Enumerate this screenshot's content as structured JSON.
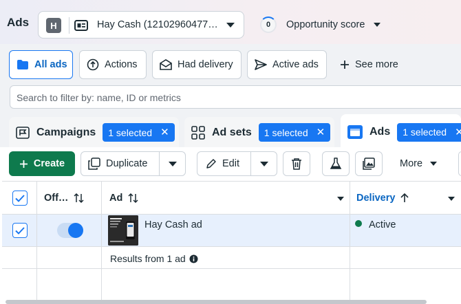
{
  "header": {
    "title": "Ads",
    "account": {
      "initial": "H",
      "name": "Hay Cash (12102960477…"
    },
    "opportunity": {
      "score": "0",
      "label": "Opportunity score"
    }
  },
  "filters": {
    "presets": [
      {
        "label": "All ads",
        "icon": "folder-icon",
        "active": true
      },
      {
        "label": "Actions",
        "icon": "actions-icon"
      },
      {
        "label": "Had delivery",
        "icon": "envelope-icon"
      },
      {
        "label": "Active ads",
        "icon": "send-icon"
      },
      {
        "label": "See more",
        "icon": "plus-icon"
      }
    ],
    "search_placeholder": "Search to filter by: name, ID or metrics"
  },
  "levels": {
    "campaigns": {
      "label": "Campaigns",
      "badge": "1 selected"
    },
    "adsets": {
      "label": "Ad sets",
      "badge": "1 selected"
    },
    "ads": {
      "label": "Ads",
      "badge": "1 selected"
    }
  },
  "toolbar": {
    "create": "Create",
    "duplicate": "Duplicate",
    "edit": "Edit",
    "more": "More"
  },
  "table": {
    "columns": {
      "off_on": "Off…",
      "ad": "Ad",
      "delivery": "Delivery"
    },
    "rows": [
      {
        "name": "Hay Cash ad",
        "delivery": "Active",
        "on": true,
        "selected": true
      }
    ],
    "summary": "Results from 1 ad"
  },
  "colors": {
    "accent": "#1877f2",
    "create": "#0e7a4d",
    "active_dot": "#0e7a4d",
    "selected_row": "#e7f0fd"
  }
}
